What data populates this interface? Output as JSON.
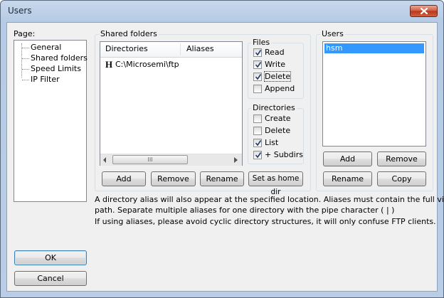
{
  "window": {
    "title": "Users"
  },
  "page": {
    "label": "Page:",
    "items": [
      {
        "label": "General"
      },
      {
        "label": "Shared folders"
      },
      {
        "label": "Speed Limits"
      },
      {
        "label": "IP Filter"
      }
    ]
  },
  "shared": {
    "title": "Shared folders",
    "col_directories": "Directories",
    "col_aliases": "Aliases",
    "row_marker": "H",
    "row_path": "C:\\Microsemi\\ftp",
    "scroll_thumb_grip": "III",
    "buttons": {
      "add": "Add",
      "remove": "Remove",
      "rename": "Rename",
      "set_home": "Set as home dir"
    }
  },
  "files": {
    "title": "Files",
    "read": {
      "label": "Read",
      "checked": true
    },
    "write": {
      "label": "Write",
      "checked": true
    },
    "delete": {
      "label": "Delete",
      "checked": true
    },
    "append": {
      "label": "Append",
      "checked": false
    }
  },
  "directories": {
    "title": "Directories",
    "create": {
      "label": "Create",
      "checked": false
    },
    "delete": {
      "label": "Delete",
      "checked": false
    },
    "list": {
      "label": "List",
      "checked": true
    },
    "subdirs": {
      "label": "+ Subdirs",
      "checked": true
    }
  },
  "users": {
    "title": "Users",
    "selected": "hsm",
    "buttons": {
      "add": "Add",
      "remove": "Remove",
      "rename": "Rename",
      "copy": "Copy"
    }
  },
  "info": {
    "line1": "A directory alias will also appear at the specified location. Aliases must contain the full virtual",
    "line2": "path. Separate multiple aliases for one directory with the pipe character ( | )",
    "line3": "If using aliases, please avoid cyclic directory structures, it will only confuse FTP clients."
  },
  "dialog": {
    "ok": "OK",
    "cancel": "Cancel"
  }
}
